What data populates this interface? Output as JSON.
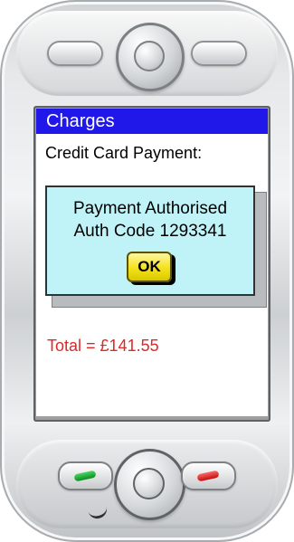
{
  "screen": {
    "title": "Charges",
    "subtitle": "Credit Card Payment:",
    "dialog": {
      "line1": "Payment Authorised",
      "line2": "Auth Code 1293341",
      "button_label": "OK"
    },
    "total": "Total = £141.55"
  }
}
